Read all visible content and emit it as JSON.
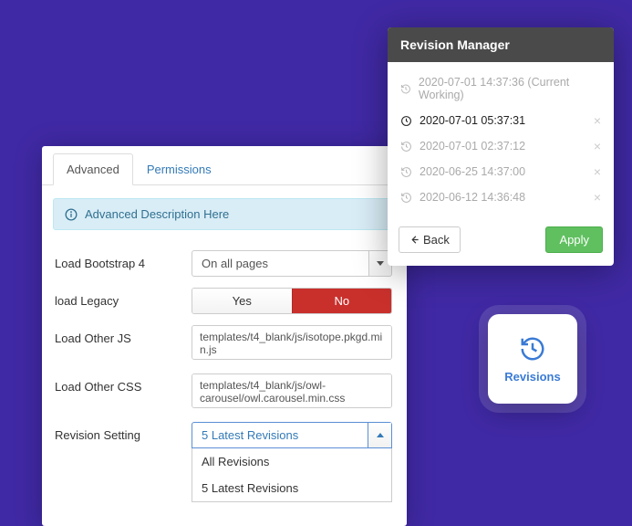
{
  "settings": {
    "tabs": {
      "advanced": "Advanced",
      "permissions": "Permissions"
    },
    "alert": "Advanced Description Here",
    "fields": {
      "load_bootstrap4": {
        "label": "Load Bootstrap 4",
        "value": "On all pages"
      },
      "load_legacy": {
        "label": "load Legacy",
        "yes": "Yes",
        "no": "No"
      },
      "load_other_js": {
        "label": "Load Other JS",
        "value": "templates/t4_blank/js/isotope.pkgd.min.js"
      },
      "load_other_css": {
        "label": "Load Other CSS",
        "value": "templates/t4_blank/js/owl-carousel/owl.carousel.min.css"
      },
      "revision_setting": {
        "label": "Revision Setting",
        "selected": "5 Latest Revisions",
        "options": [
          "All Revisions",
          "5 Latest Revisions"
        ]
      }
    }
  },
  "revision_manager": {
    "title": "Revision Manager",
    "entries": [
      {
        "ts": "2020-07-01 14:37:36 (Current Working)",
        "active": false,
        "closable": false
      },
      {
        "ts": "2020-07-01 05:37:31",
        "active": true,
        "closable": true
      },
      {
        "ts": "2020-07-01 02:37:12",
        "active": false,
        "closable": true
      },
      {
        "ts": "2020-06-25 14:37:00",
        "active": false,
        "closable": true
      },
      {
        "ts": "2020-06-12 14:36:48",
        "active": false,
        "closable": true
      }
    ],
    "back": "Back",
    "apply": "Apply"
  },
  "tile": {
    "label": "Revisions"
  }
}
